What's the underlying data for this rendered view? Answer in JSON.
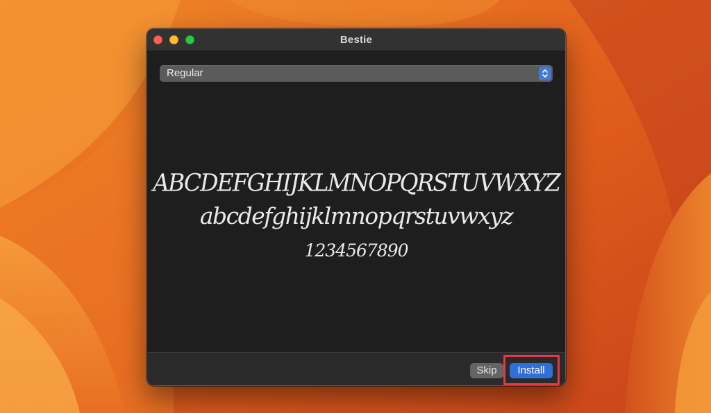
{
  "window": {
    "title": "Bestie"
  },
  "style_select": {
    "selected": "Regular"
  },
  "preview": {
    "uppercase": "ABCDEFGHIJKLMNOPQRSTUVWXYZ",
    "lowercase": "abcdefghijklmnopqrstuvwxyz",
    "digits": "1234567890"
  },
  "buttons": {
    "skip": "Skip",
    "install": "Install"
  },
  "colors": {
    "accent": "#2f6fd9",
    "highlight": "#e5384a",
    "window_bg": "#1e1e1e",
    "wallpaper": "#e0651f"
  },
  "icons": {
    "stepper": "chevron-up-down-icon"
  }
}
